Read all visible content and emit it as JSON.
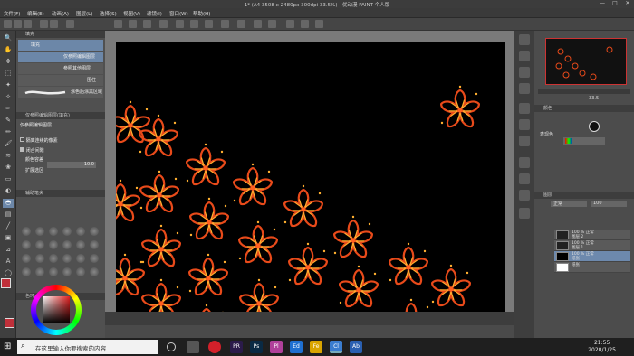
{
  "window": {
    "title": "1* (A4 3508 x 2480px 300dpi 33.5%) - 优动漫 PAINT 个人版",
    "minimize": "—",
    "maximize": "□",
    "close": "✕"
  },
  "menu": [
    "文件(F)",
    "编辑(E)",
    "动画(A)",
    "图层(L)",
    "选择(S)",
    "视图(V)",
    "滤镜(I)",
    "窗口(W)",
    "帮助(H)"
  ],
  "left_panel": {
    "subtool_header": "填充",
    "subtool_items": [
      "填充",
      "仅参照编辑图层",
      "参照其他图层",
      "围住",
      "涂色后涂黑区域"
    ],
    "tool_property_header": "仅参照编辑图层(填充)",
    "tool_property_title": "仅参照编辑图层",
    "options": [
      "隔离连续的像素",
      "闭合间隙",
      "颜色容差",
      "扩展选区"
    ],
    "tolerance_value": "10.0",
    "brush_size_header": "辅助笔尖",
    "color_header": "色环"
  },
  "right_panel": {
    "navigator_header": "导航器",
    "zoom_value": "33.5",
    "color_set_header": "颜色",
    "tone_label": "表现色",
    "layer_header": "图层",
    "layer_mode": "正常",
    "opacity": "100",
    "layers": [
      {
        "name": "100 % 正常",
        "sub": "图层 2",
        "selected": false
      },
      {
        "name": "100 % 正常",
        "sub": "图层 1",
        "selected": false
      },
      {
        "name": "100 % 正常",
        "sub": "纸张",
        "selected": true
      },
      {
        "name": "纸张",
        "sub": "",
        "selected": false
      }
    ]
  },
  "taskbar": {
    "search_placeholder": "在这里输入你要搜索的内容",
    "time": "21:55",
    "date": "2020/1/25",
    "apps": [
      "PR",
      "Ps",
      "Pl",
      "Ed",
      "Fe",
      "Cl",
      "Ab"
    ]
  },
  "colors": {
    "accent": "#6c87a8",
    "canvas": "#000000",
    "flower_outer": "#e84a1a",
    "flower_inner": "#ffb030"
  }
}
